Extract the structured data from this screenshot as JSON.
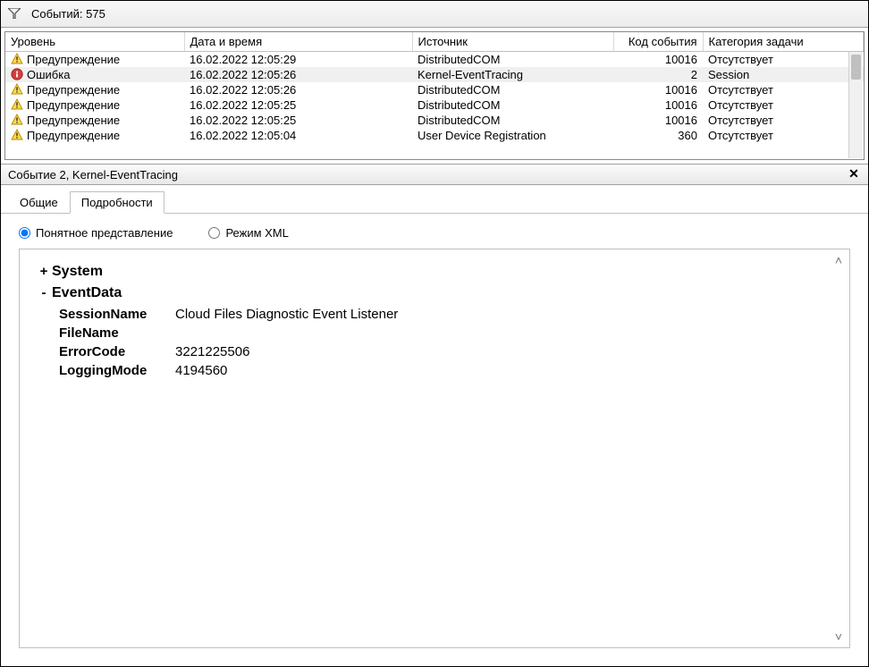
{
  "filter": {
    "label": "Событий: 575"
  },
  "columns": {
    "level": "Уровень",
    "datetime": "Дата и время",
    "source": "Источник",
    "eventid": "Код события",
    "taskcat": "Категория задачи"
  },
  "events": [
    {
      "level_icon": "warn",
      "level": "Предупреждение",
      "datetime": "16.02.2022 12:05:29",
      "source": "DistributedCOM",
      "eventid": "10016",
      "taskcat": "Отсутствует",
      "selected": false
    },
    {
      "level_icon": "error",
      "level": "Ошибка",
      "datetime": "16.02.2022 12:05:26",
      "source": "Kernel-EventTracing",
      "eventid": "2",
      "taskcat": "Session",
      "selected": true
    },
    {
      "level_icon": "warn",
      "level": "Предупреждение",
      "datetime": "16.02.2022 12:05:26",
      "source": "DistributedCOM",
      "eventid": "10016",
      "taskcat": "Отсутствует",
      "selected": false
    },
    {
      "level_icon": "warn",
      "level": "Предупреждение",
      "datetime": "16.02.2022 12:05:25",
      "source": "DistributedCOM",
      "eventid": "10016",
      "taskcat": "Отсутствует",
      "selected": false
    },
    {
      "level_icon": "warn",
      "level": "Предупреждение",
      "datetime": "16.02.2022 12:05:25",
      "source": "DistributedCOM",
      "eventid": "10016",
      "taskcat": "Отсутствует",
      "selected": false
    },
    {
      "level_icon": "warn",
      "level": "Предупреждение",
      "datetime": "16.02.2022 12:05:04",
      "source": "User Device Registration",
      "eventid": "360",
      "taskcat": "Отсутствует",
      "selected": false
    }
  ],
  "detail": {
    "header": "Событие 2, Kernel-EventTracing",
    "tabs": {
      "general": "Общие",
      "details": "Подробности"
    },
    "radios": {
      "friendly": "Понятное представление",
      "xml": "Режим XML"
    },
    "tree": {
      "system_label": "System",
      "eventdata_label": "EventData",
      "props": {
        "SessionName": {
          "label": "SessionName",
          "value": "Cloud Files Diagnostic Event Listener"
        },
        "FileName": {
          "label": "FileName",
          "value": ""
        },
        "ErrorCode": {
          "label": "ErrorCode",
          "value": "3221225506"
        },
        "LoggingMode": {
          "label": "LoggingMode",
          "value": "4194560"
        }
      }
    }
  }
}
